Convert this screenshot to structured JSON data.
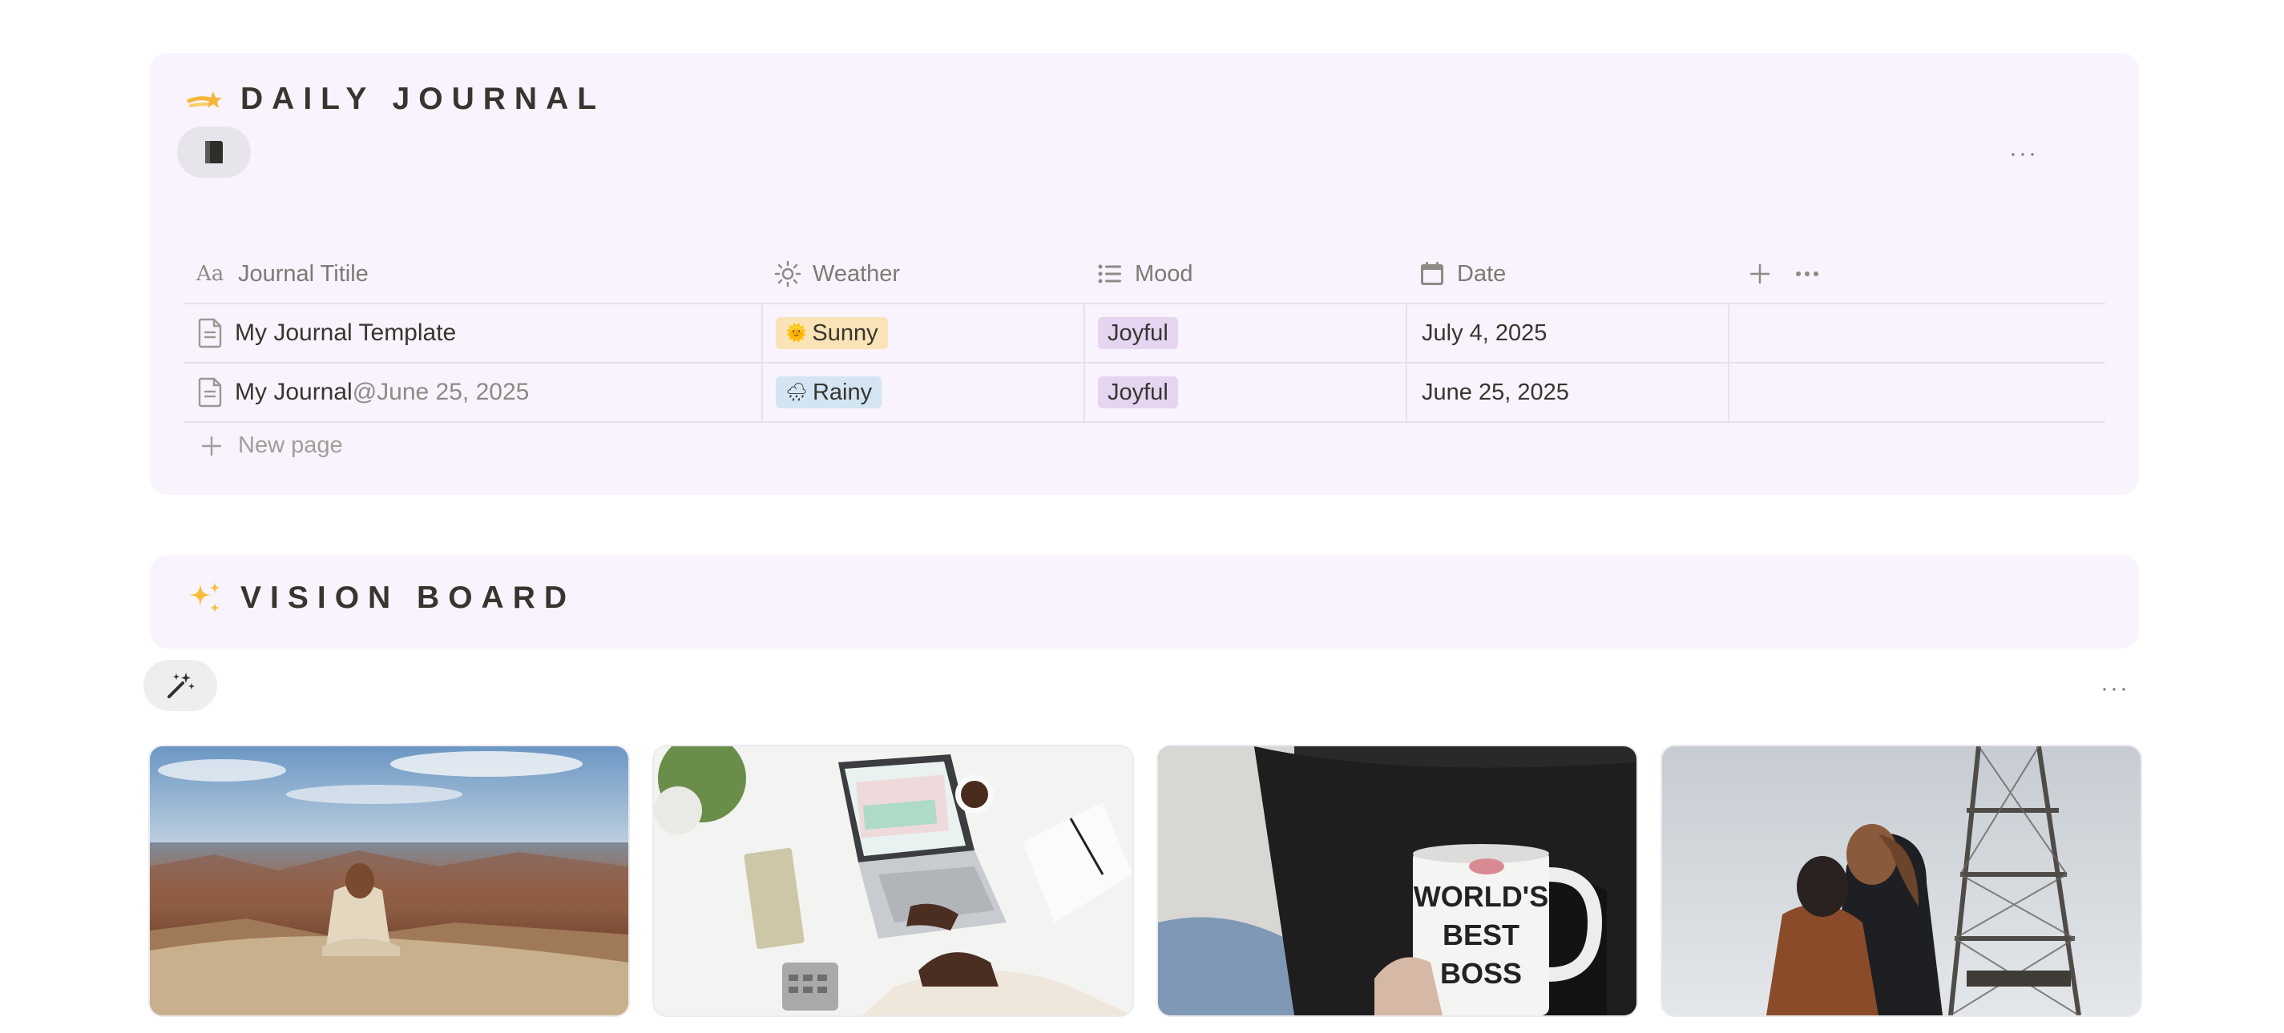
{
  "journal": {
    "title": "DAILY JOURNAL",
    "columns": {
      "title": "Journal Titile",
      "weather": "Weather",
      "mood": "Mood",
      "date": "Date"
    },
    "rows": [
      {
        "title": "My Journal Template",
        "mention": "",
        "weather": "Sunny",
        "weather_emoji": "🌞",
        "mood": "Joyful",
        "date": "July 4, 2025"
      },
      {
        "title": "My Journal",
        "mention": "@June 25, 2025",
        "weather": "Rainy",
        "weather_emoji": "🌧",
        "mood": "Joyful",
        "date": "June 25, 2025"
      }
    ],
    "new_page_label": "New page",
    "more_label": "···"
  },
  "vision": {
    "title": "VISION BOARD",
    "more_label": "···",
    "cards": [
      {
        "name": "canyon-meditation-photo"
      },
      {
        "name": "desk-laptop-photo",
        "mug_text": ""
      },
      {
        "name": "mug-photo",
        "mug_text": "WORLD'S BEST BOSS"
      },
      {
        "name": "eiffel-kiss-photo"
      }
    ]
  },
  "colors": {
    "card_bg": "#f8f3fc",
    "sunny_tag": "#fae3b7",
    "rainy_tag": "#d3e5f2",
    "mood_tag": "#e6d5f0"
  },
  "icons": {
    "journal": "shooting-star-icon",
    "vision": "sparkles-icon",
    "view": "book-icon",
    "wand": "magic-wand-icon"
  }
}
